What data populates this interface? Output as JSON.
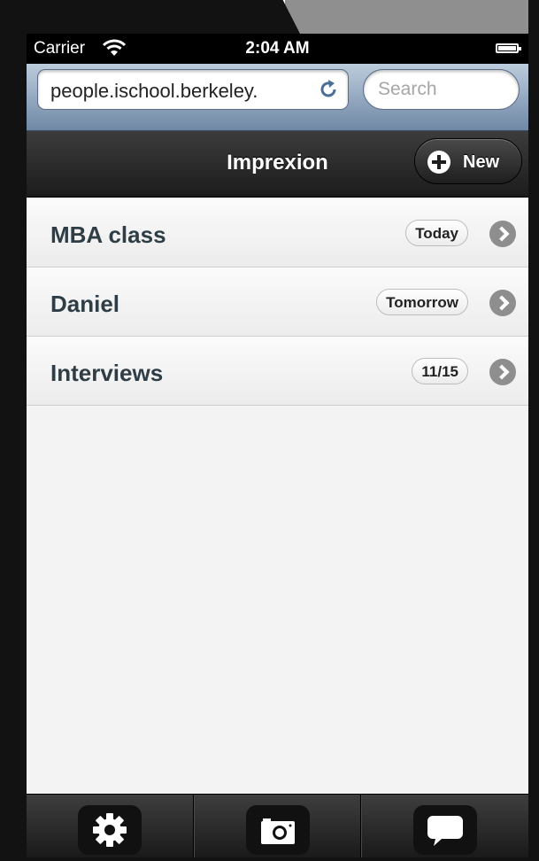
{
  "status_bar": {
    "carrier": "Carrier",
    "time": "2:04 AM",
    "wifi_icon": "wifi-icon",
    "battery_icon": "battery-icon"
  },
  "browser": {
    "address": "people.ischool.berkeley.",
    "search_placeholder": "Search",
    "reload_icon": "reload-icon"
  },
  "header": {
    "title": "Imprexion",
    "new_button_label": "New",
    "new_button_icon": "plus-icon"
  },
  "list": {
    "items": [
      {
        "title": "MBA class",
        "badge": "Today"
      },
      {
        "title": "Daniel",
        "badge": "Tomorrow"
      },
      {
        "title": "Interviews",
        "badge": "11/15"
      }
    ]
  },
  "footer": {
    "buttons": [
      {
        "icon": "gear-icon"
      },
      {
        "icon": "camera-icon"
      },
      {
        "icon": "chat-bubble-icon"
      }
    ]
  },
  "colors": {
    "header_bar": "#1c1c1c",
    "url_bar": "#6f88a6",
    "list_background": "#f3f3f3",
    "item_text": "#2f3e46"
  }
}
